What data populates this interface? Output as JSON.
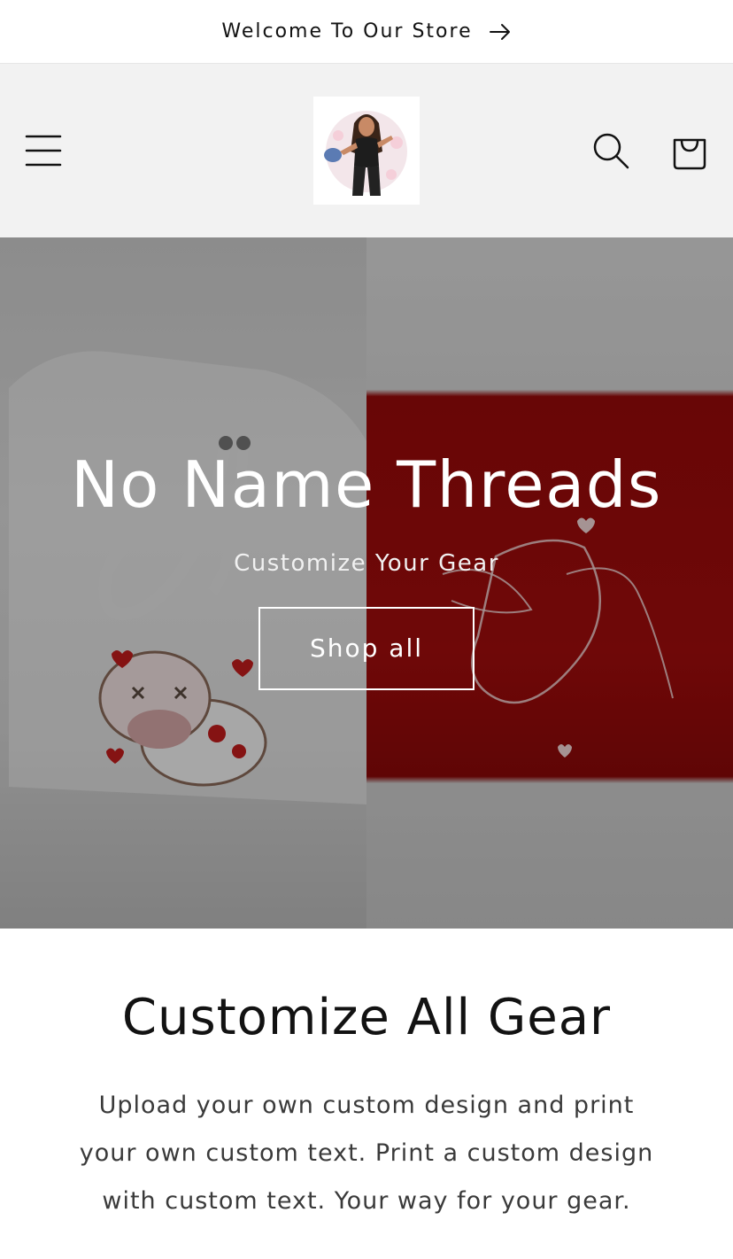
{
  "announcement": {
    "text": "Welcome To Our Store",
    "icon": "arrow-right-icon"
  },
  "header": {
    "menu_icon": "hamburger-menu-icon",
    "logo_icon": "store-logo",
    "search_icon": "search-icon",
    "cart_icon": "cart-icon"
  },
  "hero": {
    "title": "No Name Threads",
    "subtitle": "Customize Your Gear",
    "button_label": "Shop all"
  },
  "section": {
    "title": "Customize All Gear",
    "text": "Upload your own custom design and print your own custom text. Print a custom design with custom text. Your way for your gear."
  },
  "colors": {
    "header_bg": "#f2f2f2",
    "hoodie_red": "#a40c0c",
    "text_dark": "#121212"
  }
}
